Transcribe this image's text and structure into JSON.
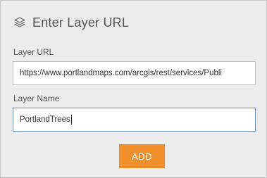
{
  "dialog": {
    "title": "Enter Layer URL",
    "header_icon": "layers-icon"
  },
  "layer_url": {
    "label": "Layer URL",
    "value": "https://www.portlandmaps.com/arcgis/rest/services/Publi"
  },
  "layer_name": {
    "label": "Layer Name",
    "value": "PortlandTrees"
  },
  "add_button": {
    "label": "ADD"
  },
  "colors": {
    "accent": "#f0902d",
    "focus_border": "#6a8dad",
    "background": "#ececec"
  }
}
